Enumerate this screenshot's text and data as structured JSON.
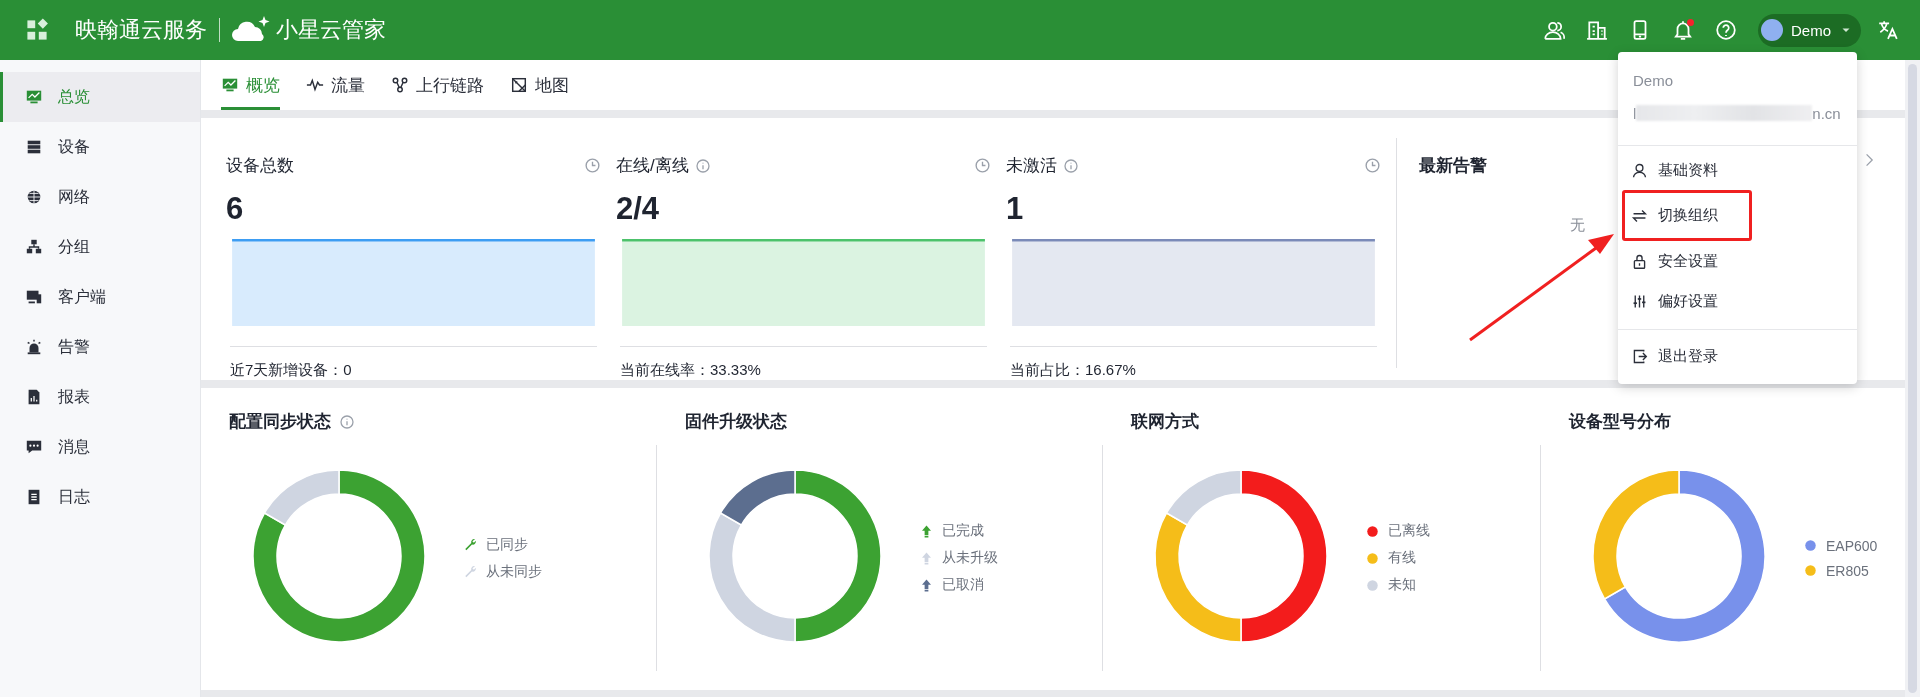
{
  "header": {
    "brand": "映翰通云服务",
    "product": "小星云管家",
    "user": "Demo",
    "has_notification": true
  },
  "sidebar": {
    "items": [
      {
        "label": "总览",
        "selected": true
      },
      {
        "label": "设备",
        "selected": false
      },
      {
        "label": "网络",
        "selected": false
      },
      {
        "label": "分组",
        "selected": false
      },
      {
        "label": "客户端",
        "selected": false
      },
      {
        "label": "告警",
        "selected": false
      },
      {
        "label": "报表",
        "selected": false
      },
      {
        "label": "消息",
        "selected": false
      },
      {
        "label": "日志",
        "selected": false
      }
    ]
  },
  "tabs": [
    {
      "label": "概览",
      "selected": true
    },
    {
      "label": "流量",
      "selected": false
    },
    {
      "label": "上行链路",
      "selected": false
    },
    {
      "label": "地图",
      "selected": false
    }
  ],
  "stats": [
    {
      "title": "设备总数",
      "info": false,
      "value": "6",
      "color": "#3d9df3",
      "footer": "近7天新增设备：0"
    },
    {
      "title": "在线/离线",
      "info": true,
      "value": "2/4",
      "color": "#4cc26b",
      "footer": "当前在线率：33.33%"
    },
    {
      "title": "未激活",
      "info": true,
      "value": "1",
      "color": "#7a8ab8",
      "footer": "当前占比：16.67%"
    }
  ],
  "alarms": {
    "title": "最新告警",
    "empty_text": "无"
  },
  "charts": [
    {
      "title": "配置同步状态",
      "info": true,
      "chart_data": {
        "type": "donut",
        "categories": [
          "已同步",
          "从未同步"
        ],
        "values": [
          83.33,
          16.67
        ]
      },
      "legend": [
        {
          "kind": "wrench",
          "color": "#3ca232"
        },
        {
          "kind": "wrench",
          "color": "#cfd5e1"
        }
      ]
    },
    {
      "title": "固件升级状态",
      "info": false,
      "chart_data": {
        "type": "donut",
        "categories": [
          "已完成",
          "从未升级",
          "已取消"
        ],
        "values": [
          50,
          33.33,
          16.67
        ]
      },
      "legend": [
        {
          "kind": "arrow",
          "color": "#3ca232"
        },
        {
          "kind": "arrow",
          "color": "#cfd5e1"
        },
        {
          "kind": "arrow",
          "color": "#5c6e8f"
        }
      ]
    },
    {
      "title": "联网方式",
      "info": false,
      "chart_data": {
        "type": "donut",
        "categories": [
          "已离线",
          "有线",
          "未知"
        ],
        "values": [
          50,
          33.33,
          16.67
        ]
      },
      "legend": [
        {
          "kind": "dot",
          "color": "#f31c1c"
        },
        {
          "kind": "dot",
          "color": "#f5bd19"
        },
        {
          "kind": "dot",
          "color": "#cfd5e1"
        }
      ]
    },
    {
      "title": "设备型号分布",
      "info": false,
      "chart_data": {
        "type": "donut",
        "categories": [
          "EAP600",
          "ER805"
        ],
        "values": [
          66.67,
          33.33
        ]
      },
      "legend": [
        {
          "kind": "dot",
          "color": "#7891eb"
        },
        {
          "kind": "dot",
          "color": "#f5bd19"
        }
      ]
    }
  ],
  "user_menu": {
    "name": "Demo",
    "email_start": "l",
    "email_end": "n.cn",
    "items": [
      {
        "label": "基础资料",
        "highlighted": false
      },
      {
        "label": "切换组织",
        "highlighted": true
      },
      {
        "label": "安全设置",
        "highlighted": false
      },
      {
        "label": "偏好设置",
        "highlighted": false
      }
    ],
    "logout": "退出登录"
  }
}
